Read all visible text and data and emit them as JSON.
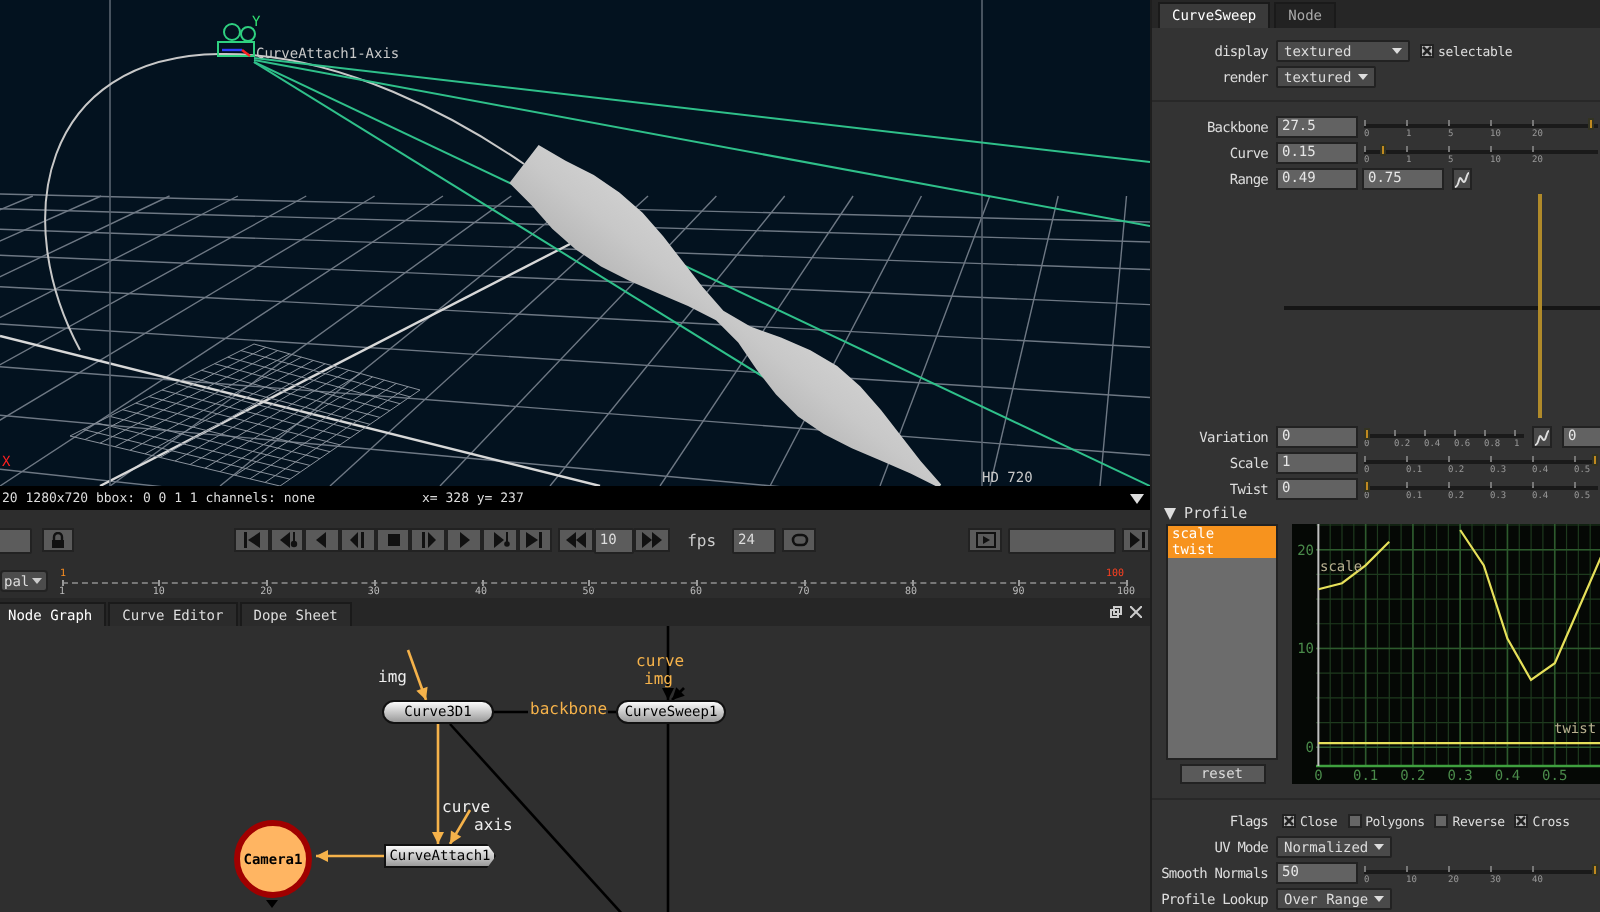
{
  "viewer": {
    "axis_label": "CurveAttach1-Axis",
    "y_axis": "Y",
    "x_axis": "X",
    "format": "HD 720",
    "info": "20 1280x720 bbox: 0 0 1 1 channels: none",
    "coords": "x= 328 y= 237"
  },
  "transport": {
    "increment": "10",
    "fps_label": "fps",
    "fps": "24"
  },
  "timeline": {
    "format": "pal",
    "in_marker": "1",
    "out_marker": "100",
    "ticks": [
      "1",
      "10",
      "20",
      "30",
      "40",
      "50",
      "60",
      "70",
      "80",
      "90",
      "100"
    ]
  },
  "node_graph": {
    "tabs": [
      {
        "label": "Node Graph",
        "selected": true
      },
      {
        "label": "Curve Editor",
        "selected": false
      },
      {
        "label": "Dope Sheet",
        "selected": false
      }
    ],
    "nodes": [
      {
        "name": "Curve3D1",
        "kind": "node"
      },
      {
        "name": "CurveSweep1",
        "kind": "node"
      },
      {
        "name": "Camera1",
        "kind": "camera"
      },
      {
        "name": "CurveAttach1",
        "kind": "attach"
      }
    ],
    "input_labels": [
      {
        "text": "img",
        "highlighted": false
      },
      {
        "text": "backbone",
        "highlighted": true
      },
      {
        "text": "curve",
        "highlighted": true
      },
      {
        "text": "img",
        "highlighted": true
      },
      {
        "text": "curve",
        "highlighted": false
      },
      {
        "text": "axis",
        "highlighted": false
      }
    ]
  },
  "properties": {
    "tabs": [
      {
        "label": "CurveSweep",
        "selected": true
      },
      {
        "label": "Node",
        "selected": false
      }
    ],
    "display": {
      "label": "display",
      "value": "textured",
      "checkbox": {
        "label": "selectable",
        "checked": true
      }
    },
    "render": {
      "label": "render",
      "value": "textured"
    },
    "knobs": [
      {
        "kind": "slider",
        "label": "Backbone",
        "value": "27.5",
        "level": 0.98,
        "ticks": [
          "0",
          "1",
          "5",
          "10",
          "20"
        ]
      },
      {
        "kind": "slider",
        "label": "Curve",
        "value": "0.15",
        "level": 0.07,
        "ticks": [
          "0",
          "1",
          "5",
          "10",
          "20"
        ]
      },
      {
        "kind": "range",
        "label": "Range",
        "values": [
          "0.49",
          "0.75"
        ]
      },
      {
        "kind": "graph"
      },
      {
        "kind": "curve_slider",
        "label": "Variation",
        "value": "0",
        "level": 0,
        "ticks": [
          "0",
          "0.2",
          "0.4",
          "0.6",
          "0.8",
          "1"
        ],
        "extra": "0"
      },
      {
        "kind": "slider",
        "label": "Scale",
        "value": "1",
        "level": 1,
        "ticks": [
          "0",
          "0.1",
          "0.2",
          "0.3",
          "0.4",
          "0.5"
        ]
      },
      {
        "kind": "slider",
        "label": "Twist",
        "value": "0",
        "level": 0,
        "ticks": [
          "0",
          "0.1",
          "0.2",
          "0.3",
          "0.4",
          "0.5"
        ]
      }
    ],
    "profile": {
      "title": "Profile",
      "expanded": true,
      "curves": [
        {
          "label": "scale",
          "selected": true
        },
        {
          "label": "twist",
          "selected": true
        }
      ],
      "reset": "reset",
      "chart_data": {
        "type": "line",
        "x": [
          0,
          0.05,
          0.1,
          0.15,
          0.2,
          0.25,
          0.3,
          0.35,
          0.4,
          0.45,
          0.5,
          0.55,
          0.6
        ],
        "series": [
          {
            "name": "scale",
            "color": "#e6e05a",
            "values": [
              16,
              16.6,
              18.4,
              20.8,
              null,
              null,
              22,
              18.4,
              11,
              6.8,
              8.5,
              14,
              19.5
            ]
          },
          {
            "name": "twist",
            "color": "#e6e05a",
            "values": [
              0.4,
              0.4,
              0.4,
              0.4,
              0.4,
              0.4,
              0.4,
              0.4,
              0.4,
              0.4,
              0.4,
              0.4,
              0.4
            ]
          }
        ],
        "xlim": [
          -0.005,
          0.6
        ],
        "ylim": [
          -1.9,
          22.6
        ],
        "xticks": [
          0,
          0.1,
          0.2,
          0.3,
          0.4,
          0.5
        ],
        "yticks": [
          0,
          10,
          20
        ],
        "grid": true
      }
    },
    "options": [
      {
        "kind": "flags",
        "label": "Flags",
        "flags": [
          {
            "label": "Close",
            "checked": true
          },
          {
            "label": "Polygons",
            "checked": false
          },
          {
            "label": "Reverse",
            "checked": false
          },
          {
            "label": "Cross",
            "checked": true
          }
        ]
      },
      {
        "kind": "dropdown",
        "label": "UV Mode",
        "value": "Normalized"
      },
      {
        "kind": "slider",
        "label": "Smooth Normals",
        "value": "50",
        "level": 1,
        "ticks": [
          "0",
          "10",
          "20",
          "30",
          "40"
        ]
      },
      {
        "kind": "dropdown",
        "label": "Profile Lookup",
        "value": "Over Range"
      }
    ]
  }
}
